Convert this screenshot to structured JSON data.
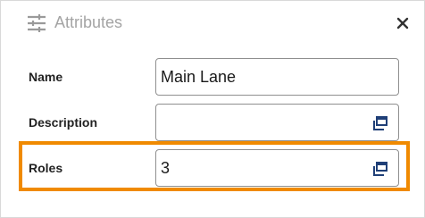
{
  "panel": {
    "title": "Attributes",
    "icons": {
      "header": "sliders-icon",
      "close": "close-icon",
      "field_action": "open-window-icon"
    }
  },
  "fields": {
    "name": {
      "label": "Name",
      "value": "Main Lane"
    },
    "description": {
      "label": "Description",
      "value": ""
    },
    "roles": {
      "label": "Roles",
      "value": "3"
    }
  },
  "colors": {
    "highlight": "#f08a00",
    "icon_blue": "#1f3f77",
    "title_gray": "#a4a4a4"
  }
}
